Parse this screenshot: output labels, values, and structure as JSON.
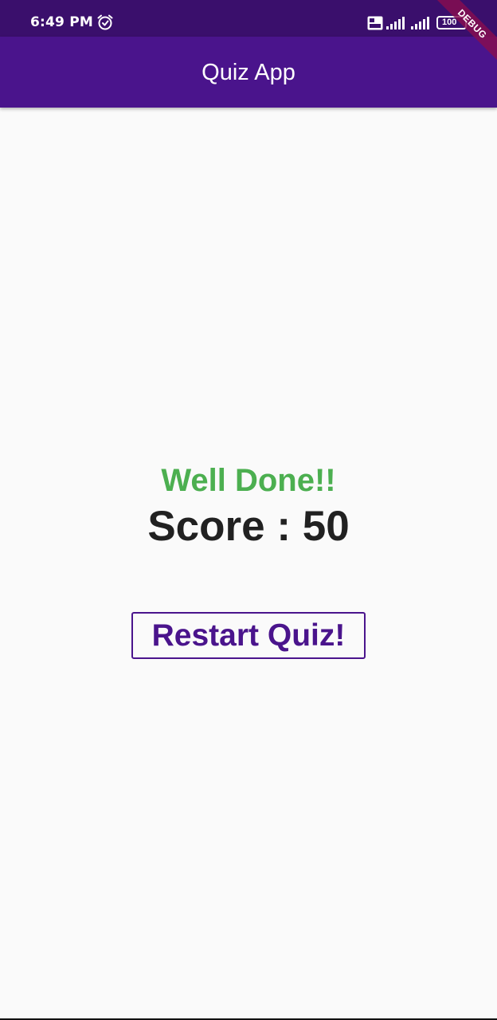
{
  "status_bar": {
    "time": "6:49 PM",
    "battery": "100",
    "icons": [
      "alarm-icon",
      "volte-icon",
      "signal-icon",
      "signal-icon",
      "battery-icon"
    ]
  },
  "app_bar": {
    "title": "Quiz App"
  },
  "debug_banner": "DEBUG",
  "result": {
    "message": "Well Done!!",
    "score_text": "Score : 50"
  },
  "actions": {
    "restart_label": "Restart Quiz!"
  },
  "colors": {
    "status_bar": "#3a0f6c",
    "app_bar": "#4a148c",
    "success": "#4caf50",
    "score": "#212121",
    "accent": "#4a148c",
    "background": "#fafafa"
  }
}
